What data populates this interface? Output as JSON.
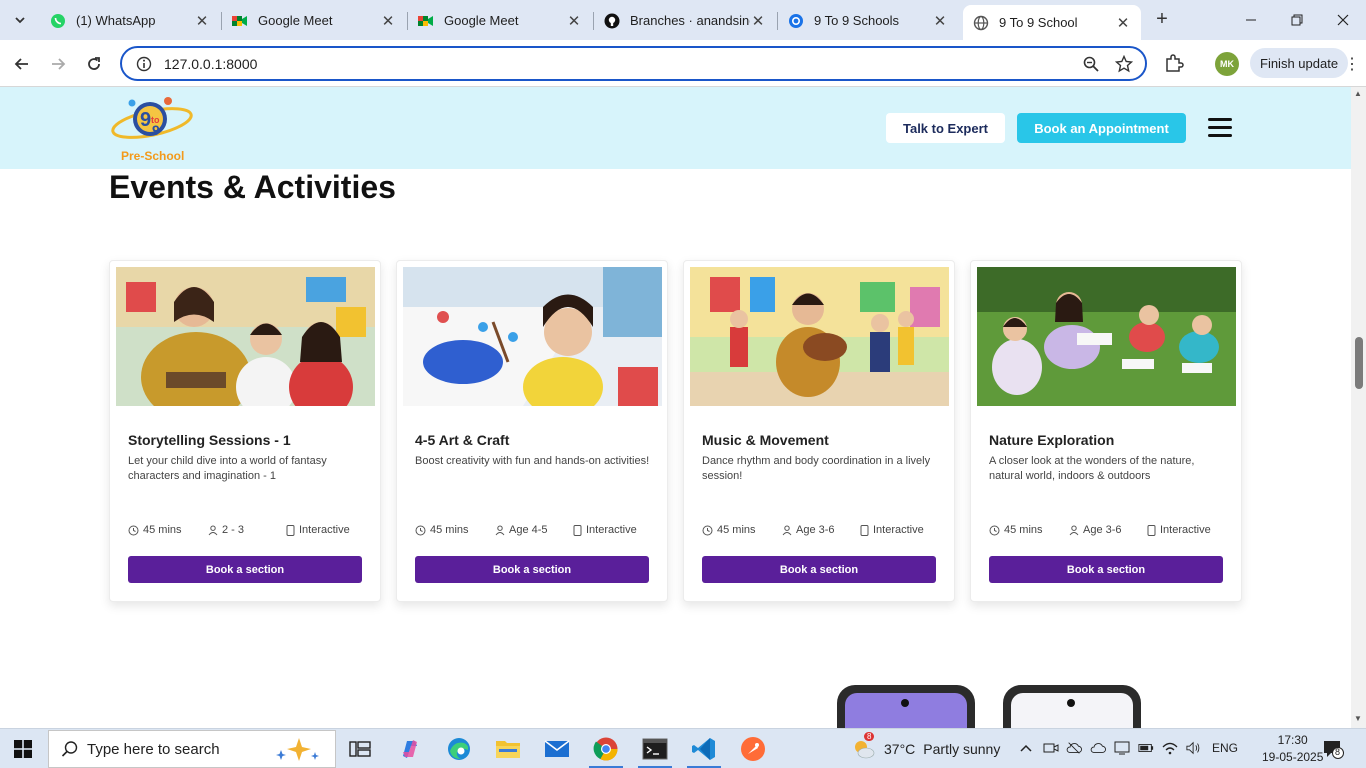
{
  "browser": {
    "tabs": [
      {
        "title": "(1) WhatsApp",
        "icon": "whatsapp-icon",
        "active": false
      },
      {
        "title": "Google Meet",
        "icon": "google-meet-icon",
        "active": false
      },
      {
        "title": "Google Meet",
        "icon": "google-meet-icon",
        "active": false
      },
      {
        "title": "Branches · anandsing",
        "icon": "github-icon",
        "active": false
      },
      {
        "title": "9 To 9 Schools",
        "icon": "globe-icon",
        "active": false
      },
      {
        "title": "9 To 9 School",
        "icon": "globe-icon",
        "active": true
      }
    ],
    "url": "127.0.0.1:8000",
    "finish_update_label": "Finish update",
    "profile_initials": "MK"
  },
  "site": {
    "logo_text": "Pre-School",
    "talk_to_expert_label": "Talk to Expert",
    "book_appointment_label": "Book an Appointment",
    "section_title": "Events & Activities",
    "cards": [
      {
        "title": "Storytelling Sessions - 1",
        "description": "Let your child dive into a world of fantasy characters and imagination - 1",
        "duration": "45 mins",
        "age": "2 - 3",
        "mode": "Interactive",
        "button": "Book a section",
        "image": "storytelling-photo"
      },
      {
        "title": "4-5 Art & Craft",
        "description": "Boost creativity with fun and hands-on activities!",
        "duration": "45 mins",
        "age": "Age 4-5",
        "mode": "Interactive",
        "button": "Book a section",
        "image": "art-craft-photo"
      },
      {
        "title": "Music & Movement",
        "description": "Dance rhythm and body coordination in a lively session!",
        "duration": "45 mins",
        "age": "Age 3-6",
        "mode": "Interactive",
        "button": "Book a section",
        "image": "music-movement-photo"
      },
      {
        "title": "Nature Exploration",
        "description": "A closer look at the wonders of the nature, natural world, indoors & outdoors",
        "duration": "45 mins",
        "age": "Age 3-6",
        "mode": "Interactive",
        "button": "Book a section",
        "image": "nature-exploration-photo"
      }
    ],
    "colors": {
      "header_bg": "#d7f4fb",
      "appointment_button": "#29c6e8",
      "book_button": "#5a1f9a"
    }
  },
  "taskbar": {
    "search_placeholder": "Type here to search",
    "weather_temp": "37°C",
    "weather_text": "Partly sunny",
    "weather_badge": "8",
    "language": "ENG",
    "time": "17:30",
    "date": "19-05-2025",
    "notification_count": "8"
  }
}
